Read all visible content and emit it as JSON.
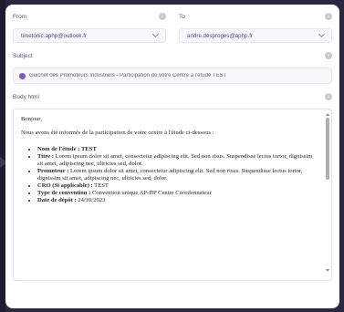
{
  "form": {
    "from": {
      "label": "From",
      "value": "timetonic.aphp@outlook.fr"
    },
    "to": {
      "label": "To",
      "value": "andre.desproges@aphp.fr"
    },
    "subject": {
      "label": "Subject",
      "value": "Guichet des Promoteurs Industriels - Participation de votre Centre à l'étude TEST"
    },
    "body": {
      "label": "Body html",
      "greeting": "Bonjour,",
      "intro": "Nous avons été informés de la participation de votre centre à l'étude ci-dessous :",
      "items": [
        {
          "key": "Nom de l'étude :",
          "value": "TEST"
        },
        {
          "key": "Titre :",
          "value": "Lorem ipsum dolor sit amet, consectetur adipiscing elit. Sed non risus. Suspendisse lectus tortor, dignissim sit amet, adipiscing nec, ultricies sed, dolor."
        },
        {
          "key": "Promoteur :",
          "value": "Lorem ipsum dolor sit amet, consectetur adipiscing elit. Sed non risus. Suspendisse lectus tortor, dignissim sit amet, adipiscing nec, ultricies sed, dolor."
        },
        {
          "key": "CRO (Si applicable) :",
          "value": "TEST"
        },
        {
          "key": "Type de convention :",
          "value": "Convention unique AP-HP Centre Coordonnateur"
        },
        {
          "key": "Date de dépôt :",
          "value": "24/10/2023"
        }
      ]
    }
  },
  "icons": {
    "info": "info-icon",
    "dropdown": "chevron-down-icon",
    "subject_status": "status-dot-icon"
  },
  "colors": {
    "accent": "#7b5bb5",
    "background": "#2b2740"
  }
}
